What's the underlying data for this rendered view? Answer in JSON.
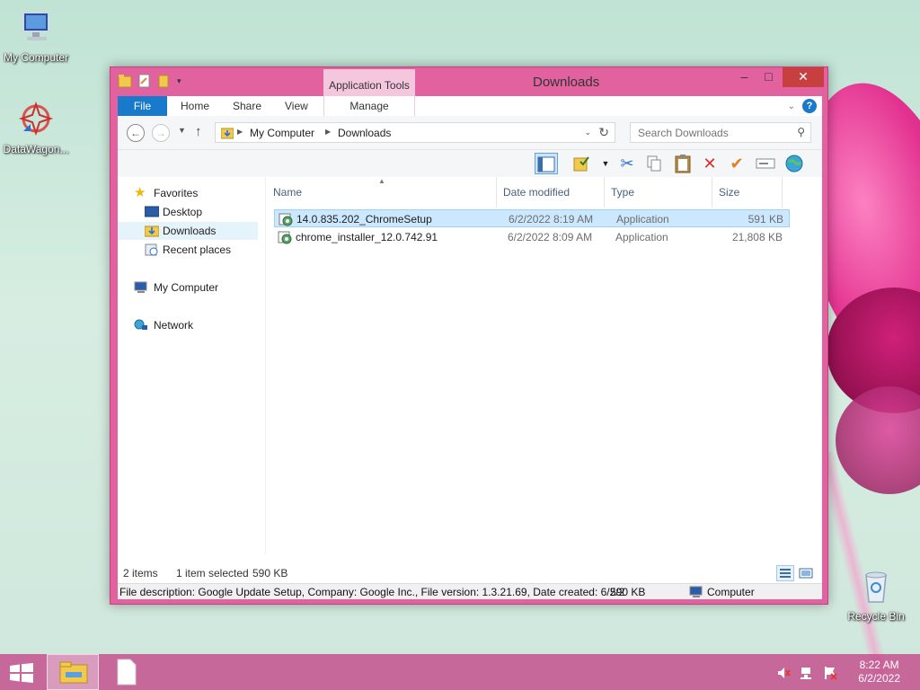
{
  "desktop": {
    "icons": [
      {
        "label": "My Computer"
      },
      {
        "label": "DataWagon..."
      },
      {
        "label": "Recycle Bin"
      }
    ]
  },
  "window": {
    "title": "Downloads",
    "contextual_tab_group": "Application Tools",
    "ribbon_tabs": {
      "file": "File",
      "home": "Home",
      "share": "Share",
      "view": "View",
      "manage": "Manage"
    },
    "help": "?",
    "controls": {
      "minimize": "–",
      "maximize": "□",
      "close": "✕"
    }
  },
  "address": {
    "breadcrumbs": [
      "My Computer",
      "Downloads"
    ],
    "search_placeholder": "Search Downloads"
  },
  "nav_pane": {
    "favorites": "Favorites",
    "desktop": "Desktop",
    "downloads": "Downloads",
    "recent": "Recent places",
    "computer": "My Computer",
    "network": "Network"
  },
  "file_list": {
    "columns": {
      "name": "Name",
      "date": "Date modified",
      "type": "Type",
      "size": "Size"
    },
    "rows": [
      {
        "name": "14.0.835.202_ChromeSetup",
        "date": "6/2/2022 8:19 AM",
        "type": "Application",
        "size": "591 KB",
        "selected": true
      },
      {
        "name": "chrome_installer_12.0.742.91",
        "date": "6/2/2022 8:09 AM",
        "type": "Application",
        "size": "21,808 KB",
        "selected": false
      }
    ]
  },
  "status": {
    "items": "2 items",
    "selected": "1 item selected",
    "selected_size": "590 KB",
    "detail": "File description: Google Update Setup, Company: Google Inc., File version: 1.3.21.69, Date created: 6/2/2",
    "detail_size": "590 KB",
    "location": "Computer"
  },
  "taskbar": {
    "time": "8:22 AM",
    "date": "6/2/2022"
  },
  "colors": {
    "window_frame": "#e2619f",
    "file_tab": "#1979ca",
    "selection": "#cce8ff",
    "close_button": "#c7403f"
  }
}
